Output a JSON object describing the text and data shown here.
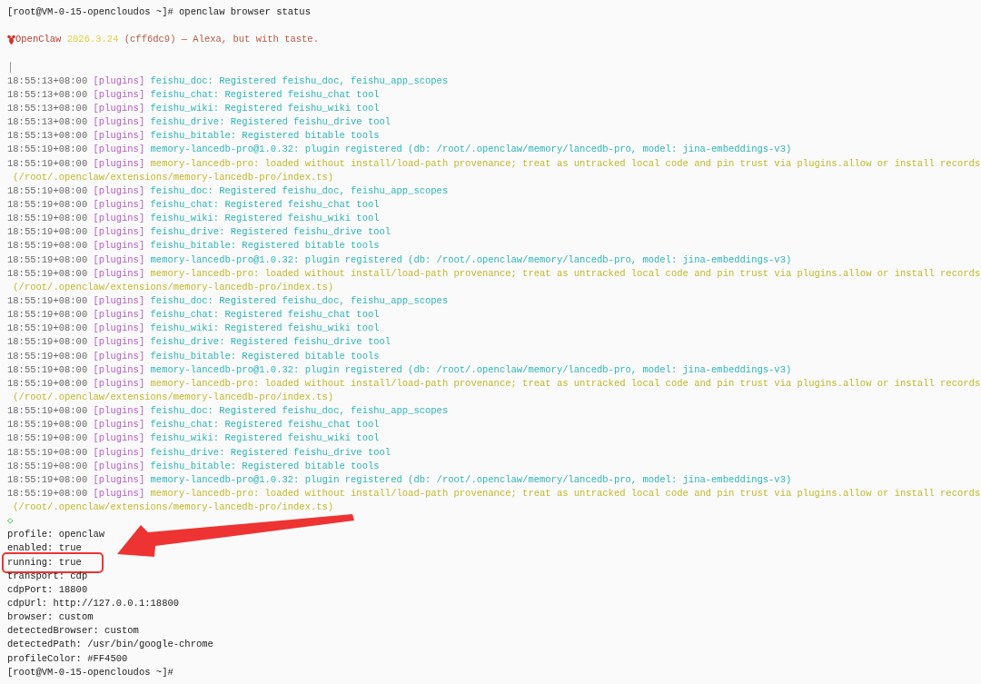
{
  "terminal": {
    "lines": [
      {
        "kind": "prompt",
        "host": "[root@VM-0-15-opencloudos ~]#",
        "command": "openclaw browser status"
      },
      {
        "kind": "blank"
      },
      {
        "kind": "banner",
        "name": "OpenClaw",
        "version": "2026.3.24",
        "tagline": "(cff6dc9) — Alexa, but with taste."
      },
      {
        "kind": "blank"
      },
      {
        "kind": "cursor",
        "text": "│"
      },
      {
        "kind": "log",
        "time": "18:55:13+08:00",
        "tag": "[plugins]",
        "color": "#2fb5b8",
        "text": "feishu_doc: Registered feishu_doc, feishu_app_scopes"
      },
      {
        "kind": "log",
        "time": "18:55:13+08:00",
        "tag": "[plugins]",
        "color": "#2fb5b8",
        "text": "feishu_chat: Registered feishu_chat tool"
      },
      {
        "kind": "log",
        "time": "18:55:13+08:00",
        "tag": "[plugins]",
        "color": "#2fb5b8",
        "text": "feishu_wiki: Registered feishu_wiki tool"
      },
      {
        "kind": "log",
        "time": "18:55:13+08:00",
        "tag": "[plugins]",
        "color": "#2fb5b8",
        "text": "feishu_drive: Registered feishu_drive tool"
      },
      {
        "kind": "log",
        "time": "18:55:13+08:00",
        "tag": "[plugins]",
        "color": "#2fb5b8",
        "text": "feishu_bitable: Registered bitable tools"
      },
      {
        "kind": "log",
        "time": "18:55:19+08:00",
        "tag": "[plugins]",
        "color": "#2fb5b8",
        "text": "memory-lancedb-pro@1.0.32: plugin registered (db: /root/.openclaw/memory/lancedb-pro, model: jina-embeddings-v3)"
      },
      {
        "kind": "log",
        "time": "18:55:19+08:00",
        "tag": "[plugins]",
        "color": "#c2b92c",
        "text": "memory-lancedb-pro: loaded without install/load-path provenance; treat as untracked local code and pin trust via plugins.allow or install records"
      },
      {
        "kind": "continuation",
        "color": "#c2b92c",
        "text": "(/root/.openclaw/extensions/memory-lancedb-pro/index.ts)"
      },
      {
        "kind": "log",
        "time": "18:55:19+08:00",
        "tag": "[plugins]",
        "color": "#2fb5b8",
        "text": "feishu_doc: Registered feishu_doc, feishu_app_scopes"
      },
      {
        "kind": "log",
        "time": "18:55:19+08:00",
        "tag": "[plugins]",
        "color": "#2fb5b8",
        "text": "feishu_chat: Registered feishu_chat tool"
      },
      {
        "kind": "log",
        "time": "18:55:19+08:00",
        "tag": "[plugins]",
        "color": "#2fb5b8",
        "text": "feishu_wiki: Registered feishu_wiki tool"
      },
      {
        "kind": "log",
        "time": "18:55:19+08:00",
        "tag": "[plugins]",
        "color": "#2fb5b8",
        "text": "feishu_drive: Registered feishu_drive tool"
      },
      {
        "kind": "log",
        "time": "18:55:19+08:00",
        "tag": "[plugins]",
        "color": "#2fb5b8",
        "text": "feishu_bitable: Registered bitable tools"
      },
      {
        "kind": "log",
        "time": "18:55:19+08:00",
        "tag": "[plugins]",
        "color": "#2fb5b8",
        "text": "memory-lancedb-pro@1.0.32: plugin registered (db: /root/.openclaw/memory/lancedb-pro, model: jina-embeddings-v3)"
      },
      {
        "kind": "log",
        "time": "18:55:19+08:00",
        "tag": "[plugins]",
        "color": "#c2b92c",
        "text": "memory-lancedb-pro: loaded without install/load-path provenance; treat as untracked local code and pin trust via plugins.allow or install records"
      },
      {
        "kind": "continuation",
        "color": "#c2b92c",
        "text": "(/root/.openclaw/extensions/memory-lancedb-pro/index.ts)"
      },
      {
        "kind": "log",
        "time": "18:55:19+08:00",
        "tag": "[plugins]",
        "color": "#2fb5b8",
        "text": "feishu_doc: Registered feishu_doc, feishu_app_scopes"
      },
      {
        "kind": "log",
        "time": "18:55:19+08:00",
        "tag": "[plugins]",
        "color": "#2fb5b8",
        "text": "feishu_chat: Registered feishu_chat tool"
      },
      {
        "kind": "log",
        "time": "18:55:19+08:00",
        "tag": "[plugins]",
        "color": "#2fb5b8",
        "text": "feishu_wiki: Registered feishu_wiki tool"
      },
      {
        "kind": "log",
        "time": "18:55:19+08:00",
        "tag": "[plugins]",
        "color": "#2fb5b8",
        "text": "feishu_drive: Registered feishu_drive tool"
      },
      {
        "kind": "log",
        "time": "18:55:19+08:00",
        "tag": "[plugins]",
        "color": "#2fb5b8",
        "text": "feishu_bitable: Registered bitable tools"
      },
      {
        "kind": "log",
        "time": "18:55:19+08:00",
        "tag": "[plugins]",
        "color": "#2fb5b8",
        "text": "memory-lancedb-pro@1.0.32: plugin registered (db: /root/.openclaw/memory/lancedb-pro, model: jina-embeddings-v3)"
      },
      {
        "kind": "log",
        "time": "18:55:19+08:00",
        "tag": "[plugins]",
        "color": "#c2b92c",
        "text": "memory-lancedb-pro: loaded without install/load-path provenance; treat as untracked local code and pin trust via plugins.allow or install records"
      },
      {
        "kind": "continuation",
        "color": "#c2b92c",
        "text": "(/root/.openclaw/extensions/memory-lancedb-pro/index.ts)"
      },
      {
        "kind": "log",
        "time": "18:55:19+08:00",
        "tag": "[plugins]",
        "color": "#2fb5b8",
        "text": "feishu_doc: Registered feishu_doc, feishu_app_scopes"
      },
      {
        "kind": "log",
        "time": "18:55:19+08:00",
        "tag": "[plugins]",
        "color": "#2fb5b8",
        "text": "feishu_chat: Registered feishu_chat tool"
      },
      {
        "kind": "log",
        "time": "18:55:19+08:00",
        "tag": "[plugins]",
        "color": "#2fb5b8",
        "text": "feishu_wiki: Registered feishu_wiki tool"
      },
      {
        "kind": "log",
        "time": "18:55:19+08:00",
        "tag": "[plugins]",
        "color": "#2fb5b8",
        "text": "feishu_drive: Registered feishu_drive tool"
      },
      {
        "kind": "log",
        "time": "18:55:19+08:00",
        "tag": "[plugins]",
        "color": "#2fb5b8",
        "text": "feishu_bitable: Registered bitable tools"
      },
      {
        "kind": "log",
        "time": "18:55:19+08:00",
        "tag": "[plugins]",
        "color": "#2fb5b8",
        "text": "memory-lancedb-pro@1.0.32: plugin registered (db: /root/.openclaw/memory/lancedb-pro, model: jina-embeddings-v3)"
      },
      {
        "kind": "log",
        "time": "18:55:19+08:00",
        "tag": "[plugins]",
        "color": "#c2b92c",
        "text": "memory-lancedb-pro: loaded without install/load-path provenance; treat as untracked local code and pin trust via plugins.allow or install records"
      },
      {
        "kind": "continuation",
        "color": "#c2b92c",
        "text": "(/root/.openclaw/extensions/memory-lancedb-pro/index.ts)"
      },
      {
        "kind": "diamond",
        "text": "◇"
      },
      {
        "kind": "output",
        "text": "profile: openclaw"
      },
      {
        "kind": "output",
        "text": "enabled: true"
      },
      {
        "kind": "output",
        "text": "running: true",
        "highlighted": true
      },
      {
        "kind": "output",
        "text": "transport: cdp"
      },
      {
        "kind": "output",
        "text": "cdpPort: 18800"
      },
      {
        "kind": "output",
        "text": "cdpUrl: http://127.0.0.1:18800"
      },
      {
        "kind": "output",
        "text": "browser: custom"
      },
      {
        "kind": "output",
        "text": "detectedBrowser: custom"
      },
      {
        "kind": "output",
        "text": "detectedPath: /usr/bin/google-chrome"
      },
      {
        "kind": "output",
        "text": "profileColor: #FF4500"
      },
      {
        "kind": "prompt",
        "host": "[root@VM-0-15-opencloudos ~]#"
      }
    ]
  }
}
